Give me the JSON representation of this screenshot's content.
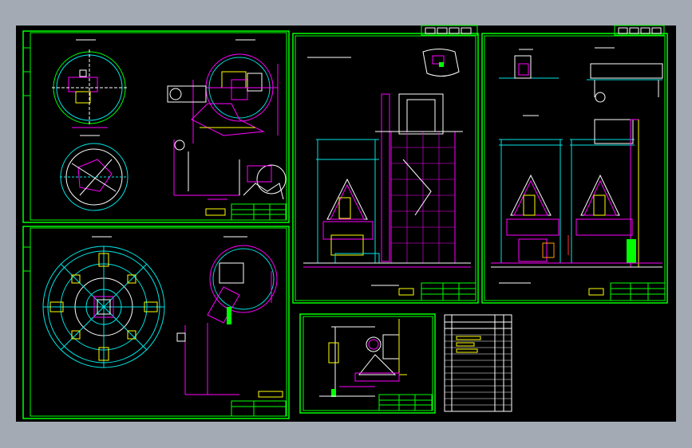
{
  "app": {
    "background": "#a3aab4",
    "sheet_background": "#000000"
  },
  "colors": {
    "frame": "#00ff00",
    "cyan": "#00e5e5",
    "magenta": "#ff00ff",
    "white": "#ffffff",
    "yellow": "#ffff00"
  },
  "drawings": [
    {
      "id": "panel-tl"
    },
    {
      "id": "panel-bl"
    },
    {
      "id": "panel-mid"
    },
    {
      "id": "panel-right"
    },
    {
      "id": "panel-small"
    },
    {
      "id": "panel-table"
    }
  ]
}
